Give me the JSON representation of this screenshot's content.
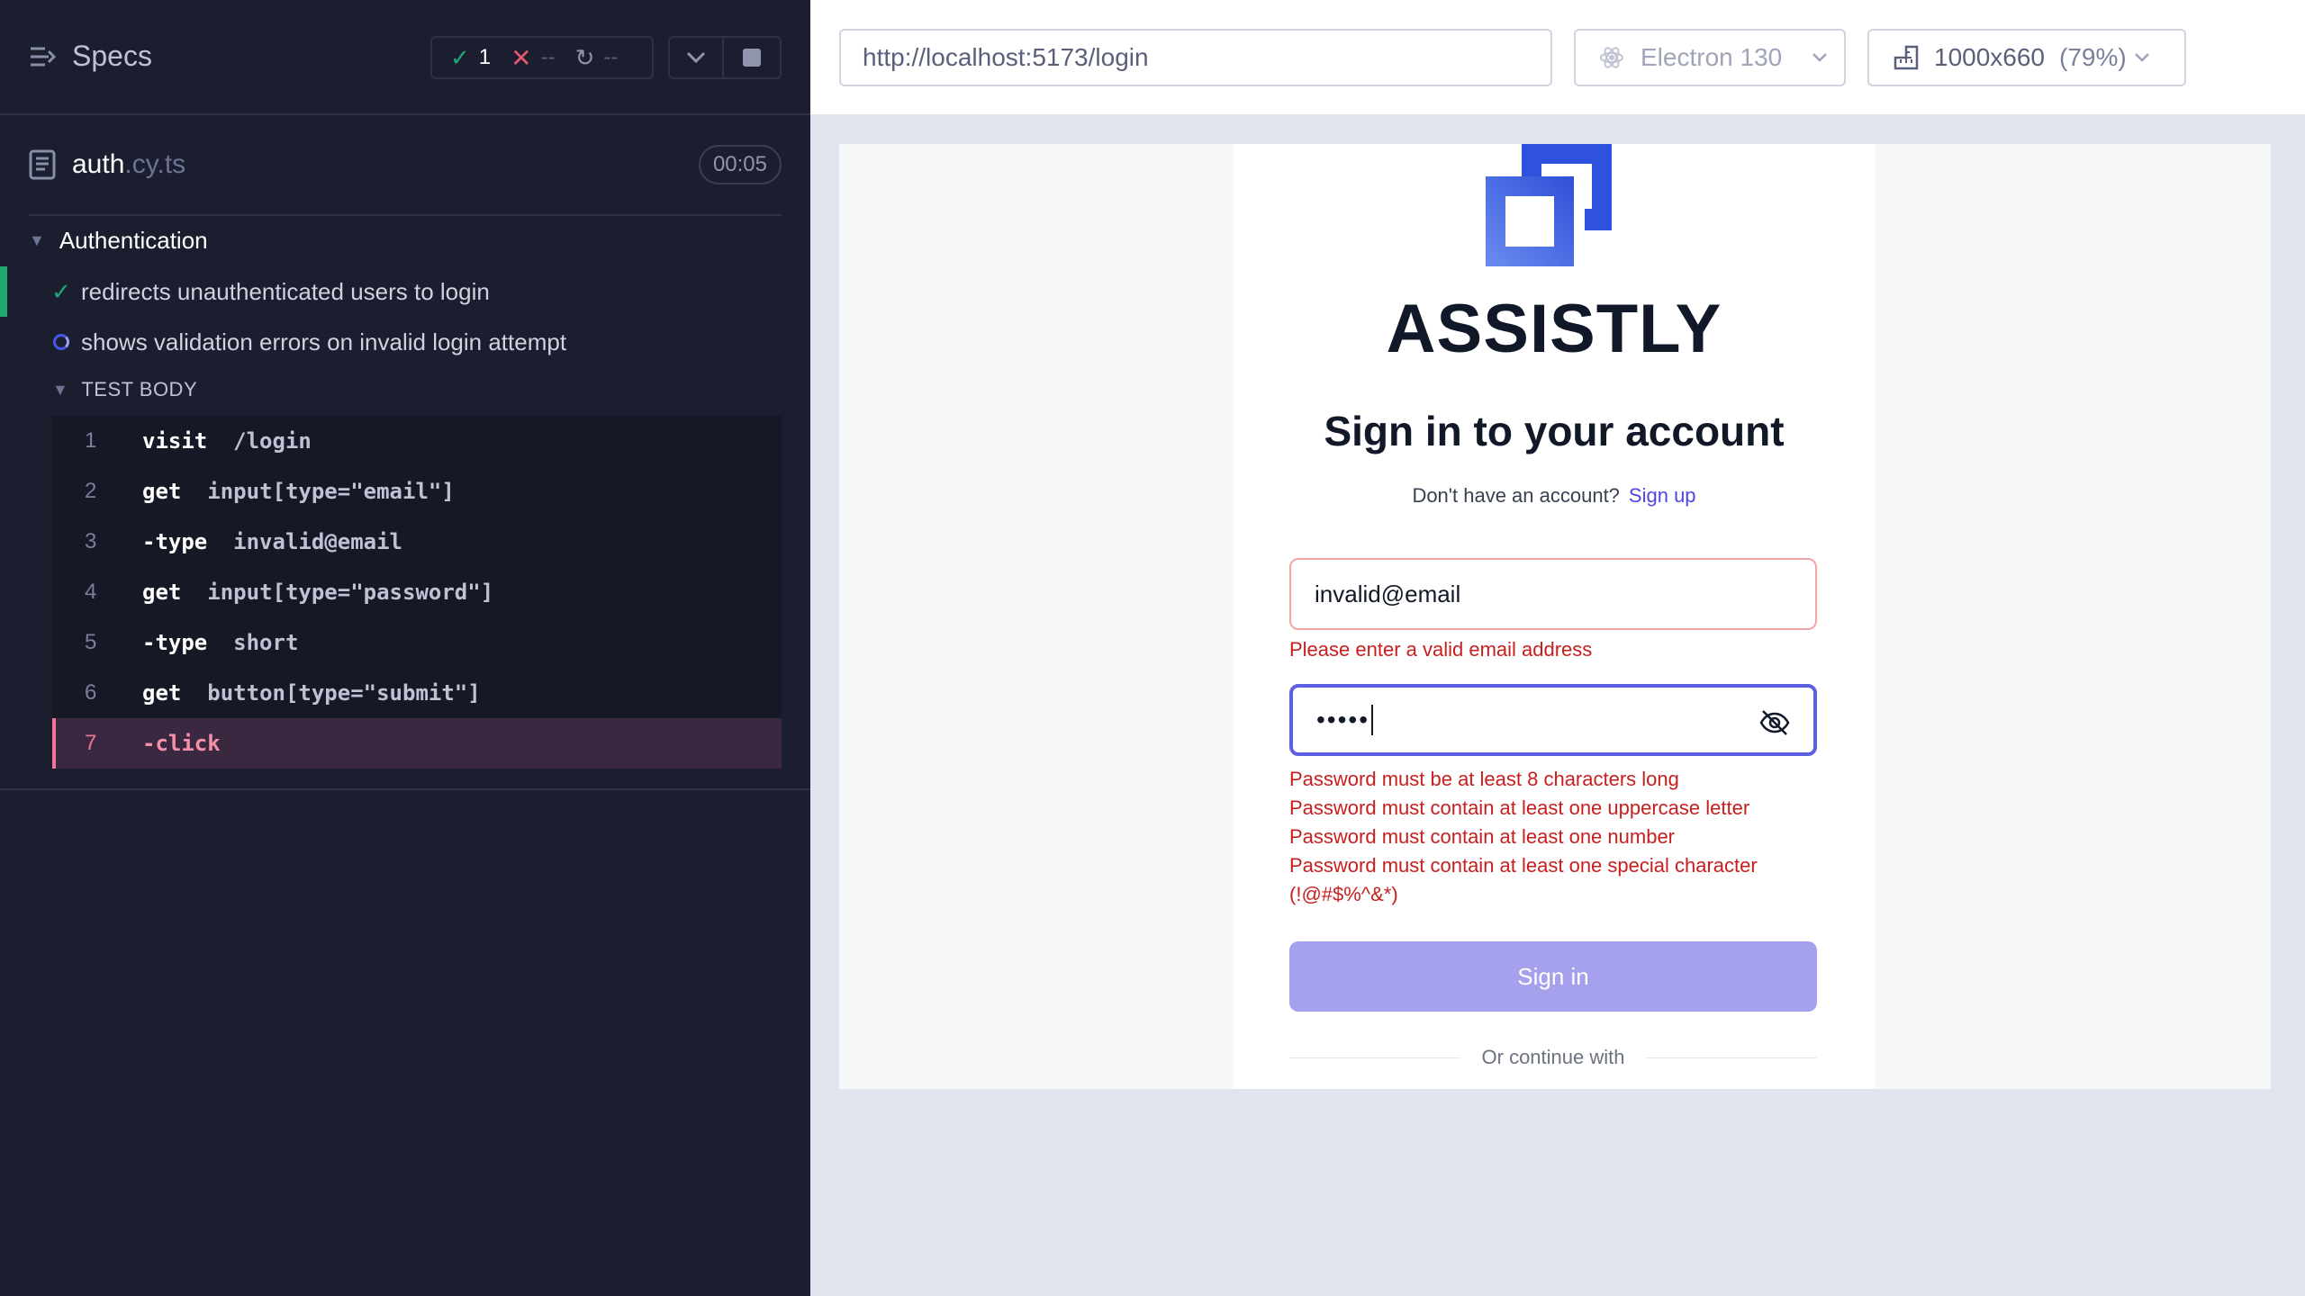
{
  "reporter": {
    "title": "Specs",
    "stats": {
      "passed": "1",
      "failed": "--",
      "pending": "--"
    },
    "file": {
      "name": "auth",
      "ext": ".cy.ts",
      "duration": "00:05"
    },
    "suite": "Authentication",
    "tests": [
      {
        "title": "redirects unauthenticated users to login",
        "state": "passed"
      },
      {
        "title": "shows validation errors on invalid login attempt",
        "state": "running"
      }
    ],
    "test_body_label": "TEST BODY",
    "commands": [
      {
        "num": "1",
        "name": "visit",
        "arg": "/login"
      },
      {
        "num": "2",
        "name": "get",
        "arg": "input[type=\"email\"]"
      },
      {
        "num": "3",
        "name": "-type",
        "arg": "invalid@email"
      },
      {
        "num": "4",
        "name": "get",
        "arg": "input[type=\"password\"]"
      },
      {
        "num": "5",
        "name": "-type",
        "arg": "short"
      },
      {
        "num": "6",
        "name": "get",
        "arg": "button[type=\"submit\"]"
      },
      {
        "num": "7",
        "name": "-click",
        "arg": ""
      }
    ]
  },
  "aut": {
    "url": "http://localhost:5173/login",
    "browser": "Electron 130",
    "viewport": "1000x660",
    "scale": "(79%)"
  },
  "login": {
    "brand": "ASSISTLY",
    "heading": "Sign in to your account",
    "no_account": "Don't have an account?",
    "signup": "Sign up",
    "email_value": "invalid@email",
    "email_error": "Please enter a valid email address",
    "password_mask": "•••••",
    "password_errors": [
      "Password must be at least 8 characters long",
      "Password must contain at least one uppercase letter",
      "Password must contain at least one number",
      "Password must contain at least one special character",
      "(!@#$%^&*)"
    ],
    "signin_button": "Sign in",
    "or_continue": "Or continue with"
  },
  "colors": {
    "reporter_bg": "#1b1e2e",
    "pass": "#1fa971",
    "fail": "#e45770",
    "active_command": "#f07596",
    "primary": "#4f46e5",
    "error": "#c81e1e"
  }
}
